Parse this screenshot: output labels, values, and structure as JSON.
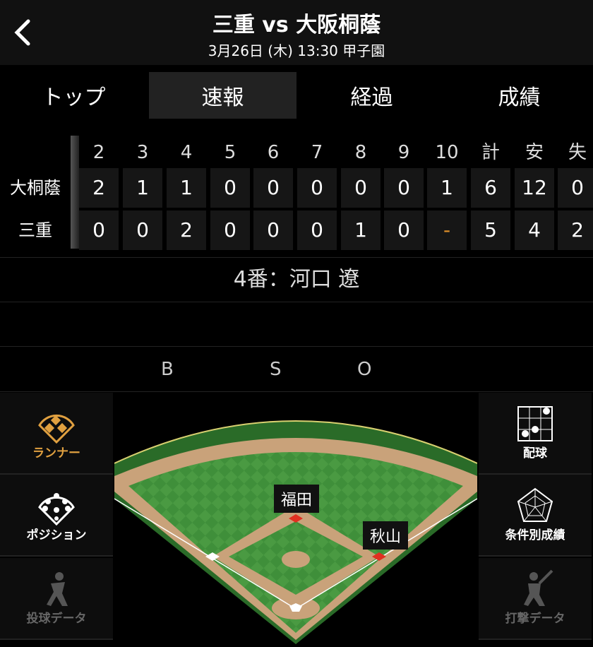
{
  "header": {
    "title": "三重 vs 大阪桐蔭",
    "subtitle": "3月26日 (木) 13:30 甲子園",
    "back_icon": "chevron-left-icon"
  },
  "tabs": [
    {
      "label": "トップ"
    },
    {
      "label": "速報",
      "active": true
    },
    {
      "label": "経過"
    },
    {
      "label": "成績"
    }
  ],
  "scoreboard": {
    "headers": [
      "2",
      "3",
      "4",
      "5",
      "6",
      "7",
      "8",
      "9",
      "10",
      "計",
      "安",
      "失"
    ],
    "teams": [
      {
        "name": "大桐蔭",
        "scores": [
          "2",
          "1",
          "1",
          "0",
          "0",
          "0",
          "0",
          "0",
          "1",
          "6",
          "12",
          "0"
        ]
      },
      {
        "name": "三重",
        "scores": [
          "0",
          "0",
          "2",
          "0",
          "0",
          "0",
          "1",
          "0",
          "-",
          "5",
          "4",
          "2"
        ]
      }
    ]
  },
  "batter": "4番：河口 遼",
  "count": {
    "b": "B",
    "s": "S",
    "o": "O"
  },
  "left_menu": [
    {
      "label": "ランナー",
      "icon": "diamond-runner-icon",
      "active": true
    },
    {
      "label": "ポジション",
      "icon": "position-icon"
    },
    {
      "label": "投球データ",
      "icon": "pitcher-icon",
      "disabled": true
    }
  ],
  "right_menu": [
    {
      "label": "配球",
      "icon": "pitch-grid-icon"
    },
    {
      "label": "条件別成績",
      "icon": "radar-icon"
    },
    {
      "label": "打撃データ",
      "icon": "batter-icon",
      "disabled": true
    }
  ],
  "runners": {
    "second": "福田",
    "first": "秋山"
  },
  "colors": {
    "accent": "#e0a040",
    "grass": "#3f8f3a",
    "dirt": "#c9a27a"
  }
}
